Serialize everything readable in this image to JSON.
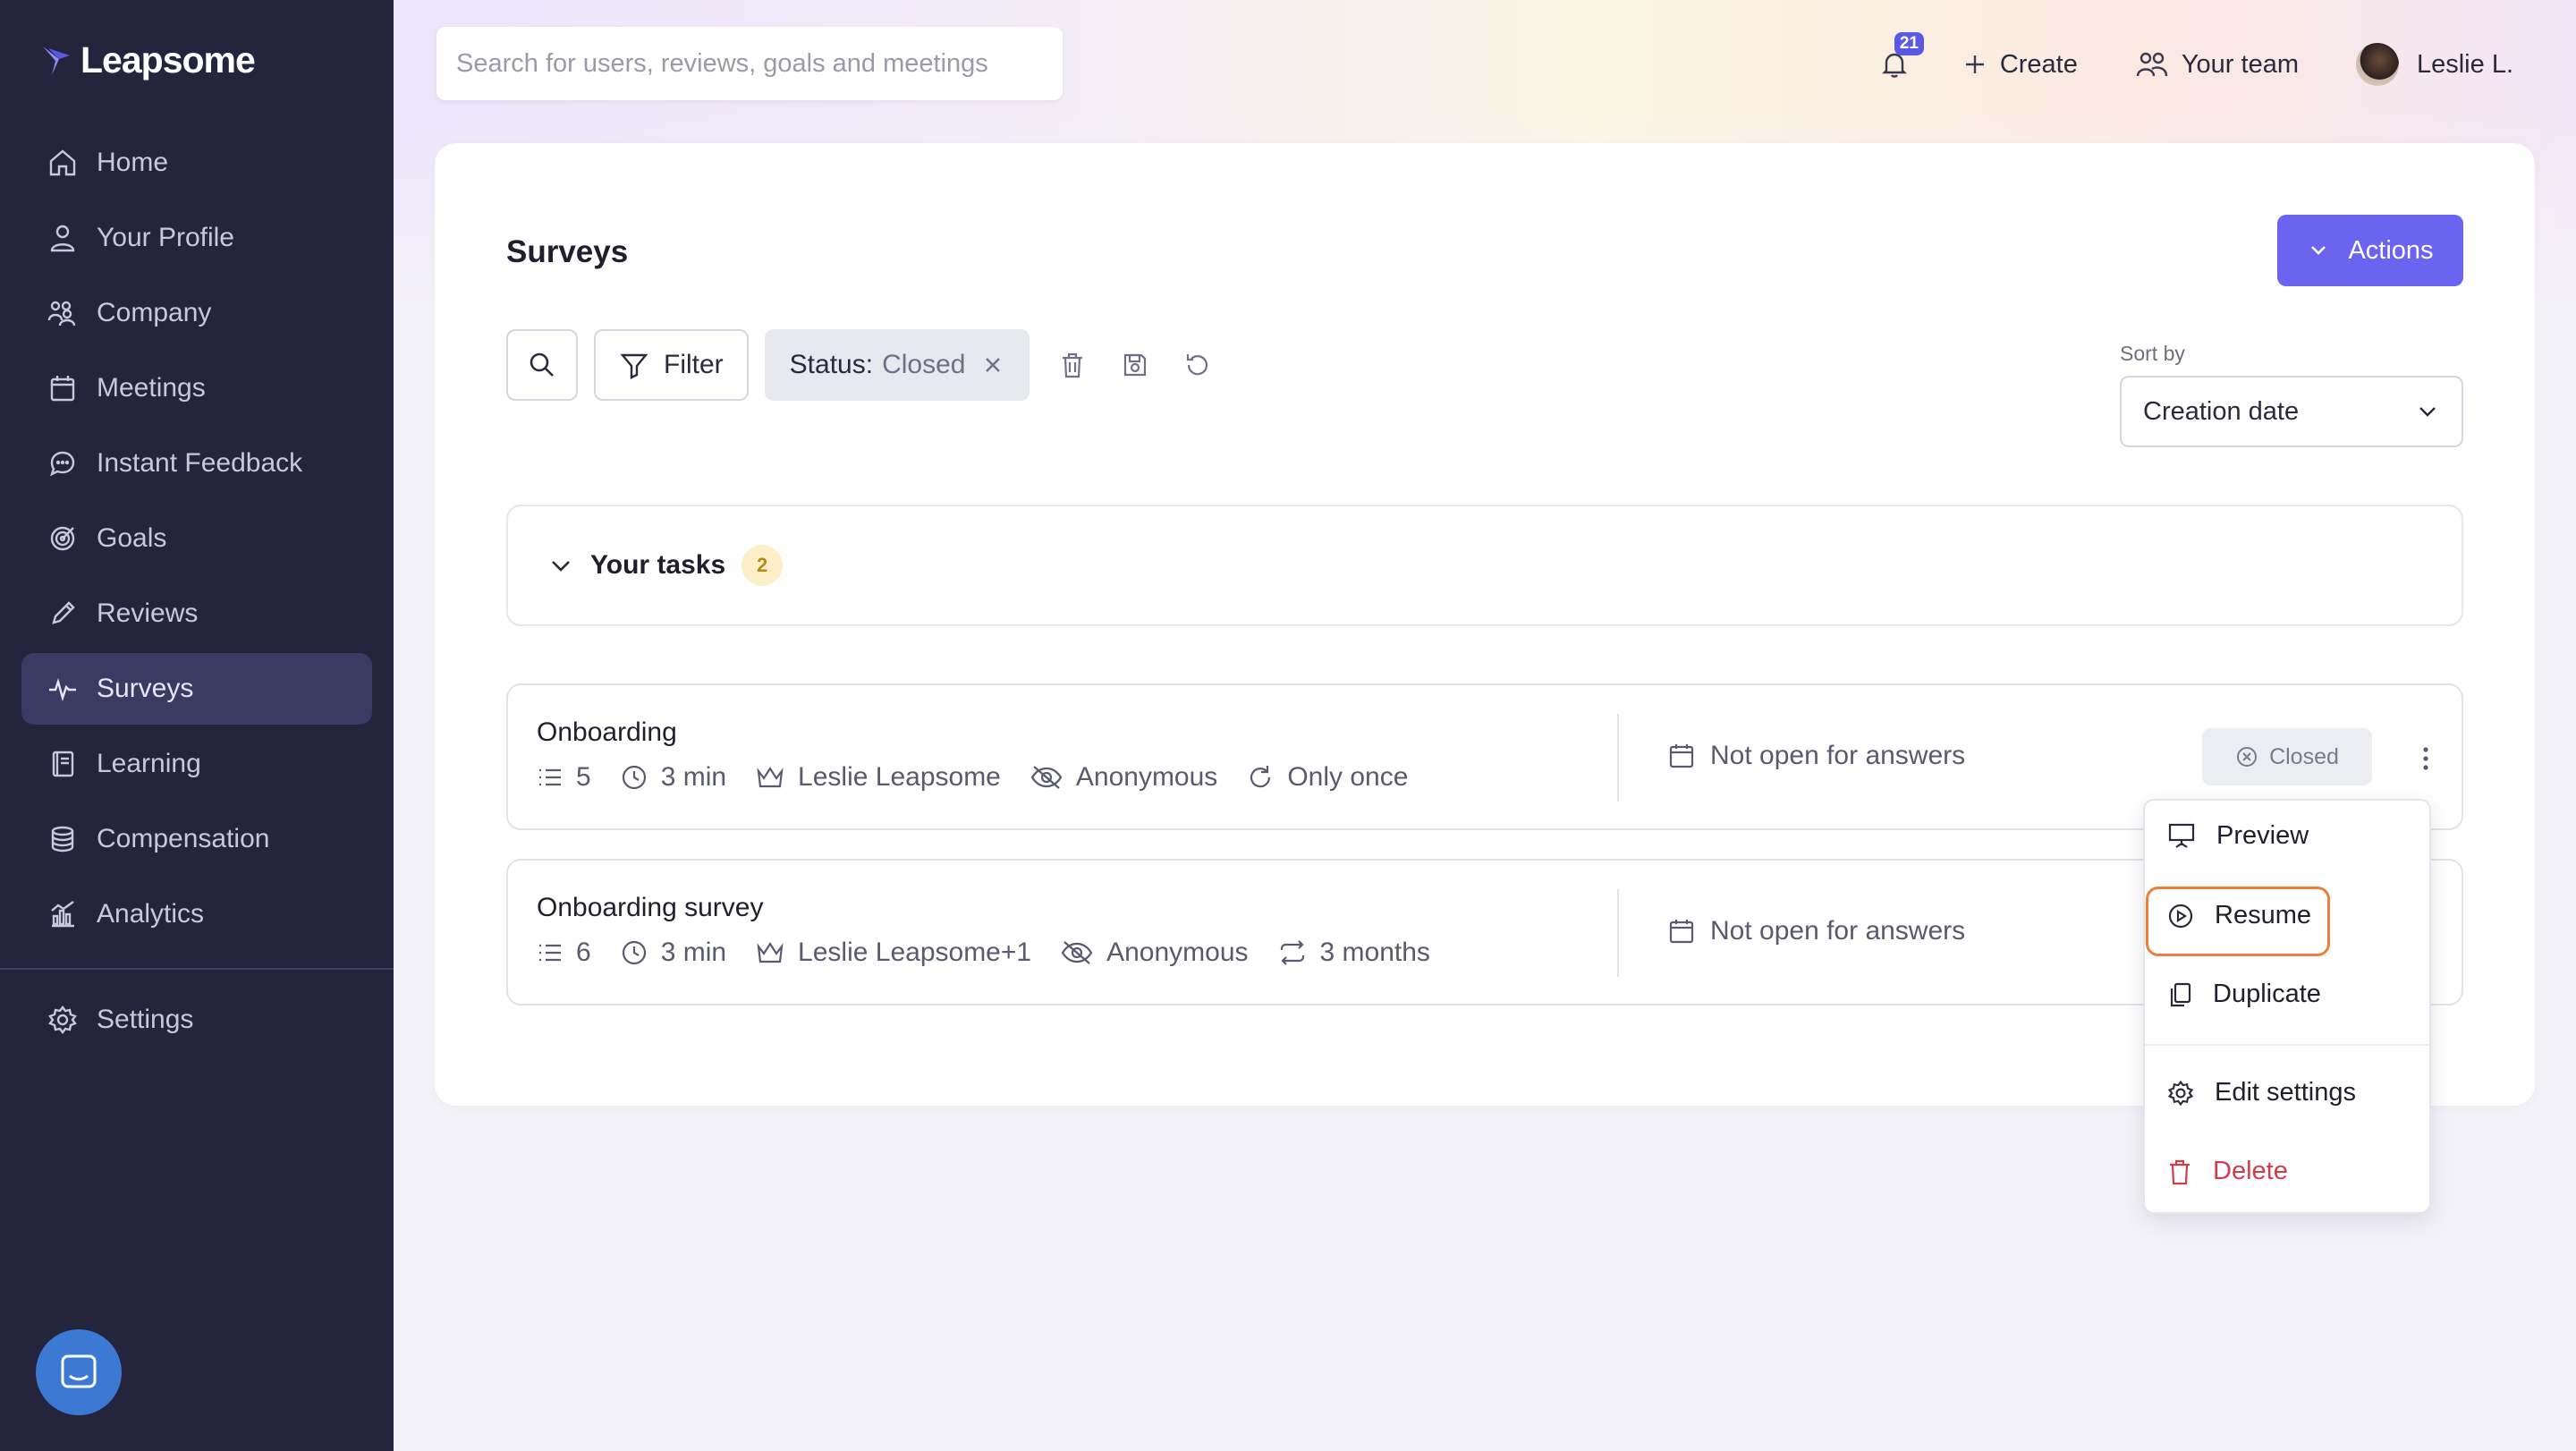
{
  "app": {
    "brand": "Leapsome"
  },
  "sidebar": {
    "items": [
      {
        "label": "Home",
        "icon": "home-icon"
      },
      {
        "label": "Your Profile",
        "icon": "user-icon"
      },
      {
        "label": "Company",
        "icon": "company-icon"
      },
      {
        "label": "Meetings",
        "icon": "calendar-icon"
      },
      {
        "label": "Instant Feedback",
        "icon": "chat-icon"
      },
      {
        "label": "Goals",
        "icon": "target-icon"
      },
      {
        "label": "Reviews",
        "icon": "pencil-icon"
      },
      {
        "label": "Surveys",
        "icon": "pulse-icon",
        "active": true
      },
      {
        "label": "Learning",
        "icon": "book-icon"
      },
      {
        "label": "Compensation",
        "icon": "coins-icon"
      },
      {
        "label": "Analytics",
        "icon": "bar-chart-icon"
      }
    ],
    "settings": {
      "label": "Settings",
      "icon": "gear-icon"
    }
  },
  "topbar": {
    "search_placeholder": "Search for users, reviews, goals and meetings",
    "notifications_count": "21",
    "create_label": "Create",
    "team_label": "Your team",
    "user_name": "Leslie L."
  },
  "main": {
    "title": "Surveys",
    "actions_label": "Actions",
    "filter_label": "Filter",
    "status_chip": {
      "key": "Status:",
      "value": "Closed"
    },
    "sort": {
      "label": "Sort by",
      "value": "Creation date"
    },
    "tasks": {
      "label": "Your tasks",
      "count": "2"
    },
    "surveys": [
      {
        "name": "Onboarding",
        "questions": "5",
        "duration": "3 min",
        "owner": "Leslie Leapsome",
        "anonymity": "Anonymous",
        "frequency": "Only once",
        "open_info": "Not open for answers",
        "status": "Closed"
      },
      {
        "name": "Onboarding survey",
        "questions": "6",
        "duration": "3 min",
        "owner": "Leslie Leapsome+1",
        "anonymity": "Anonymous",
        "frequency": "3 months",
        "open_info": "Not open for answers"
      }
    ]
  },
  "context_menu": {
    "items": [
      {
        "label": "Preview"
      },
      {
        "label": "Resume",
        "highlighted": true
      },
      {
        "label": "Duplicate"
      },
      {
        "label": "Edit settings"
      },
      {
        "label": "Delete",
        "danger": true
      }
    ]
  },
  "colors": {
    "sidebar_bg": "#25243d",
    "accent": "#6a64f0",
    "highlight": "#ef7d3b",
    "danger": "#d23c4a"
  }
}
